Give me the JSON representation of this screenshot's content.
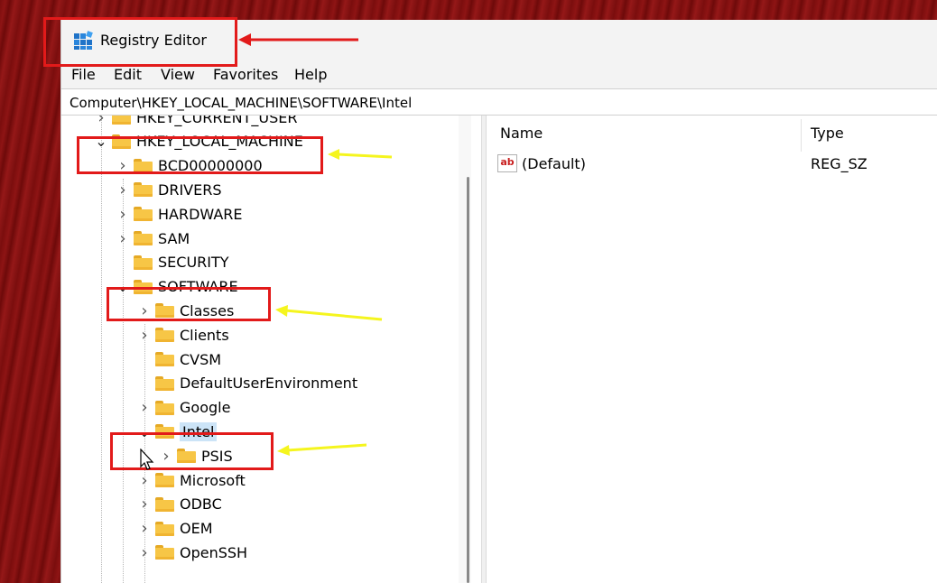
{
  "window": {
    "title": "Registry Editor"
  },
  "menu": [
    "File",
    "Edit",
    "View",
    "Favorites",
    "Help"
  ],
  "address": "Computer\\HKEY_LOCAL_MACHINE\\SOFTWARE\\Intel",
  "tree": [
    {
      "label": "HKEY_CURRENT_USER",
      "state": "collapsed"
    },
    {
      "label": "HKEY_LOCAL_MACHINE",
      "state": "expanded"
    },
    {
      "label": "BCD00000000",
      "state": "collapsed"
    },
    {
      "label": "DRIVERS",
      "state": "collapsed"
    },
    {
      "label": "HARDWARE",
      "state": "collapsed"
    },
    {
      "label": "SAM",
      "state": "collapsed"
    },
    {
      "label": "SECURITY",
      "state": "leaf"
    },
    {
      "label": "SOFTWARE",
      "state": "expanded"
    },
    {
      "label": "Classes",
      "state": "collapsed"
    },
    {
      "label": "Clients",
      "state": "collapsed"
    },
    {
      "label": "CVSM",
      "state": "leaf"
    },
    {
      "label": "DefaultUserEnvironment",
      "state": "leaf"
    },
    {
      "label": "Google",
      "state": "collapsed"
    },
    {
      "label": "Intel",
      "state": "expanded",
      "selected": true
    },
    {
      "label": "PSIS",
      "state": "collapsed"
    },
    {
      "label": "Microsoft",
      "state": "collapsed"
    },
    {
      "label": "ODBC",
      "state": "collapsed"
    },
    {
      "label": "OEM",
      "state": "collapsed"
    },
    {
      "label": "OpenSSH",
      "state": "collapsed"
    }
  ],
  "values_pane": {
    "columns": [
      "Name",
      "Type"
    ],
    "rows": [
      {
        "name": "(Default)",
        "type": "REG_SZ",
        "icon": "ab"
      }
    ]
  },
  "colors": {
    "annotation_box": "#e21a1a",
    "title_arrow": "#e21a1a",
    "pointer_arrows": "#f5f51e",
    "selection": "#cce4f7",
    "folder": "#f7c646"
  },
  "icons": {
    "app": "registry-editor-icon",
    "folder": "folder-icon",
    "value": "string-value-icon",
    "expander": "chevron-icon"
  }
}
